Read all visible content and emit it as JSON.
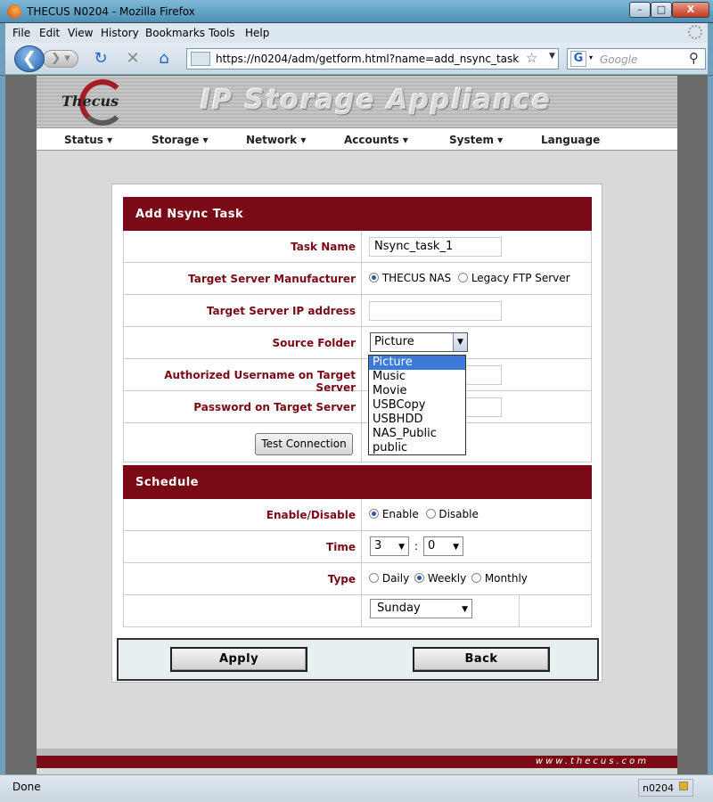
{
  "window": {
    "title": "THECUS N0204 - Mozilla Firefox",
    "min": "–",
    "max": "□",
    "close": "X"
  },
  "menu": [
    "File",
    "Edit",
    "View",
    "History",
    "Bookmarks",
    "Tools",
    "Help"
  ],
  "nav": {
    "url": "https://n0204/adm/getform.html?name=add_nsync_task",
    "search_placeholder": "Google",
    "back": "❮",
    "forward": "❯ ▾",
    "reload": "↻",
    "stop": "✕",
    "home": "⌂",
    "star": "☆",
    "drop": "▼",
    "g": "G",
    "gdrop": "▾",
    "mag": "⚲"
  },
  "banner": {
    "logo": "Thecus",
    "title": "IP Storage Appliance"
  },
  "mainnav": [
    "Status ▾",
    "Storage ▾",
    "Network ▾",
    "Accounts ▾",
    "System ▾",
    "Language"
  ],
  "task": {
    "header": "Add Nsync Task",
    "task_name_label": "Task Name",
    "task_name_value": "Nsync_task_1",
    "manufacturer_label": "Target Server Manufacturer",
    "manufacturer_opt1": "THECUS NAS",
    "manufacturer_opt2": "Legacy FTP Server",
    "ip_label": "Target Server IP address",
    "ip_value": "",
    "source_label": "Source Folder",
    "source_value": "Picture",
    "source_options": [
      "Picture",
      "Music",
      "Movie",
      "USBCopy",
      "USBHDD",
      "NAS_Public",
      "public"
    ],
    "username_label": "Authorized Username on Target Server",
    "password_label": "Password on Target Server",
    "test_button": "Test Connection"
  },
  "schedule": {
    "header": "Schedule",
    "enable_label": "Enable/Disable",
    "enable_opt": "Enable",
    "disable_opt": "Disable",
    "time_label": "Time",
    "hour": "3",
    "colon": ":",
    "minute": "0",
    "type_label": "Type",
    "daily": "Daily",
    "weekly": "Weekly",
    "monthly": "Monthly",
    "day": "Sunday"
  },
  "buttons": {
    "apply": "Apply",
    "back": "Back"
  },
  "footer": {
    "url": "www.thecus.com"
  },
  "status": {
    "text": "Done",
    "host": "n0204"
  }
}
